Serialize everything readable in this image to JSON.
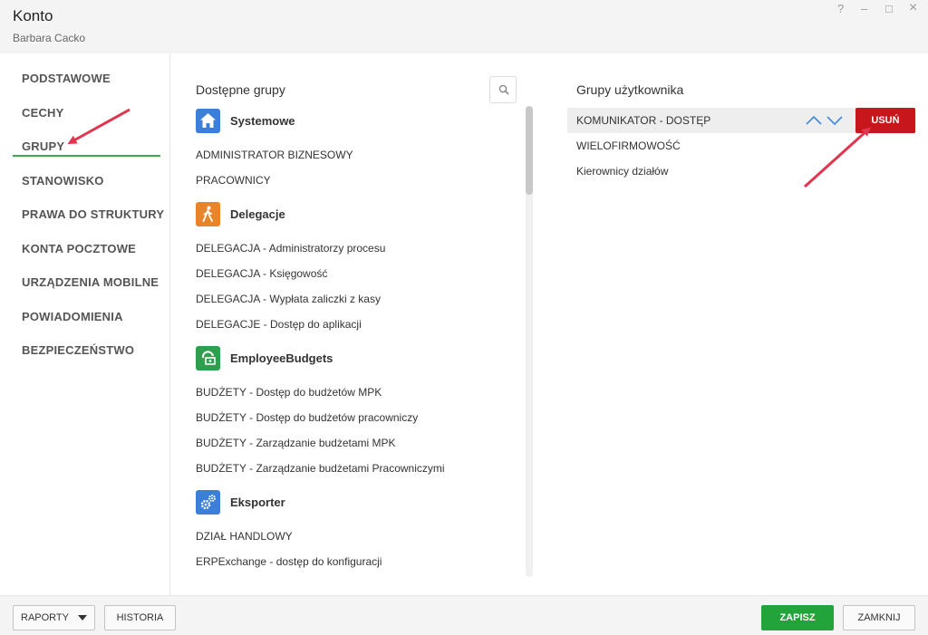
{
  "window": {
    "title": "Konto",
    "subtitle": "Barbara Cacko",
    "controls": {
      "help": "?",
      "minimize": "–",
      "maximize": "□",
      "close": "×"
    }
  },
  "sidebar": {
    "items": [
      {
        "label": "PODSTAWOWE"
      },
      {
        "label": "CECHY"
      },
      {
        "label": "GRUPY",
        "active": true
      },
      {
        "label": "STANOWISKO"
      },
      {
        "label": "PRAWA DO STRUKTURY"
      },
      {
        "label": "KONTA POCZTOWE"
      },
      {
        "label": "URZĄDZENIA MOBILNE"
      },
      {
        "label": "POWIADOMIENIA"
      },
      {
        "label": "BEZPIECZEŃSTWO"
      }
    ]
  },
  "available": {
    "title": "Dostępne grupy",
    "categories": [
      {
        "label": "Systemowe",
        "icon": "home-icon",
        "color": "#3b7fd9",
        "items": [
          "ADMINISTRATOR BIZNESOWY",
          "PRACOWNICY"
        ]
      },
      {
        "label": "Delegacje",
        "icon": "walking-person-icon",
        "color": "#e8852a",
        "items": [
          "DELEGACJA - Administratorzy procesu",
          "DELEGACJA - Księgowość",
          "DELEGACJA - Wypłata zaliczki z kasy",
          "DELEGACJE - Dostęp do aplikacji"
        ]
      },
      {
        "label": "EmployeeBudgets",
        "icon": "budget-icon",
        "color": "#2f9e4f",
        "items": [
          "BUDŻETY - Dostęp do budżetów MPK",
          "BUDŻETY - Dostęp do budżetów pracowniczy",
          "BUDŻETY - Zarządzanie budżetami MPK",
          "BUDŻETY - Zarządzanie budżetami Pracowniczymi"
        ]
      },
      {
        "label": "Eksporter",
        "icon": "gears-icon",
        "color": "#3b7fd9",
        "items": [
          "DZIAŁ HANDLOWY",
          "ERPExchange - dostęp do konfiguracji"
        ]
      }
    ]
  },
  "user_groups": {
    "title": "Grupy użytkownika",
    "items": [
      "KOMUNIKATOR - DOSTĘP",
      "WIELOFIRMOWOŚĆ",
      "Kierownicy działów"
    ],
    "delete_label": "USUŃ"
  },
  "footer": {
    "reports_label": "RAPORTY",
    "history_label": "HISTORIA",
    "save_label": "ZAPISZ",
    "close_label": "ZAMKNIJ"
  },
  "colors": {
    "accent_green": "#22a43a",
    "danger_red": "#c8161d",
    "annotation_arrow": "#e0344f"
  }
}
